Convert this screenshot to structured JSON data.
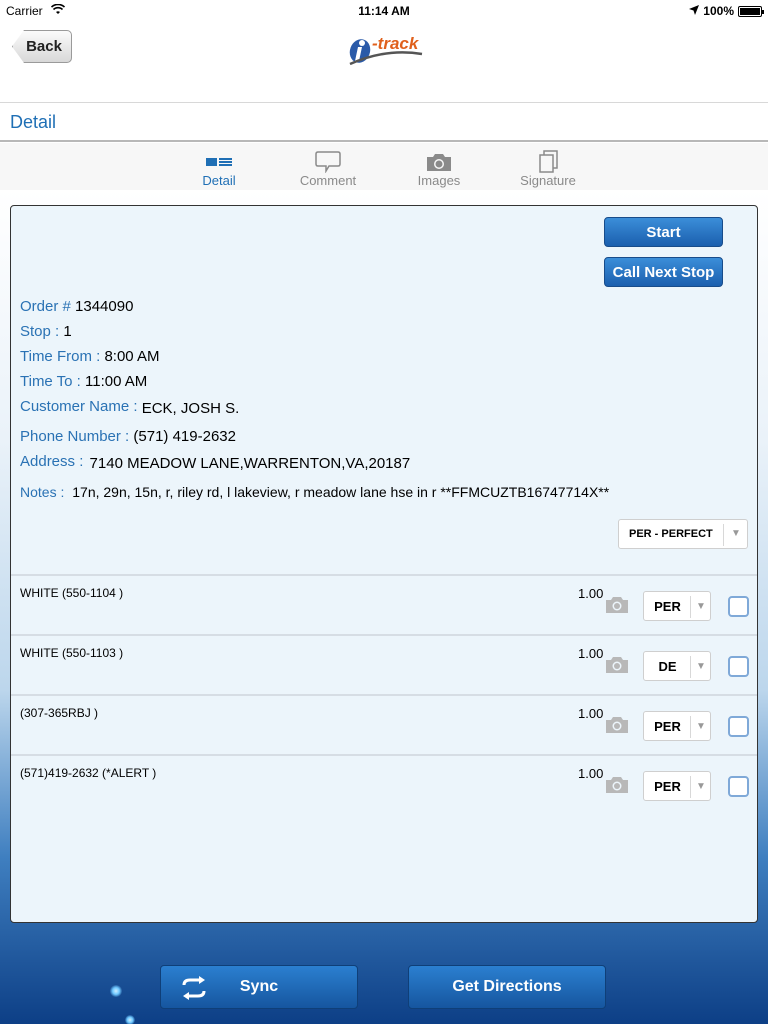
{
  "status_bar": {
    "carrier": "Carrier",
    "time": "11:14 AM",
    "battery": "100%"
  },
  "nav": {
    "back_label": "Back",
    "logo_text": "-track"
  },
  "page_title": "Detail",
  "tabs": [
    {
      "label": "Detail",
      "icon": "list-icon",
      "active": true
    },
    {
      "label": "Comment",
      "icon": "comment-bubble-icon",
      "active": false
    },
    {
      "label": "Images",
      "icon": "camera-icon",
      "active": false
    },
    {
      "label": "Signature",
      "icon": "document-stack-icon",
      "active": false
    }
  ],
  "actions": {
    "start_label": "Start",
    "call_next_label": "Call Next Stop"
  },
  "details": {
    "order": {
      "label": "Order #",
      "value": "1344090"
    },
    "stop": {
      "label": "Stop :",
      "value": "1"
    },
    "time_from": {
      "label": "Time From :",
      "value": "8:00 AM"
    },
    "time_to": {
      "label": "Time To :",
      "value": "11:00 AM"
    },
    "customer": {
      "label": "Customer Name :",
      "value": "ECK, JOSH S."
    },
    "phone": {
      "label": "Phone Number :",
      "value": "(571) 419-2632"
    },
    "address": {
      "label": "Address :",
      "value": "7140 MEADOW LANE,WARRENTON,VA,20187"
    },
    "notes": {
      "label": "Notes :",
      "value": "17n, 29n, 15n, r, riley rd, l lakeview, r meadow lane hse in r **FFMCUZTB16747714X**"
    }
  },
  "order_status": "PER - PERFECT",
  "items": [
    {
      "name": "WHITE (550-1104 )",
      "qty": "1.00",
      "status": "PER",
      "checked": false
    },
    {
      "name": "WHITE (550-1103 )",
      "qty": "1.00",
      "status": "DE",
      "checked": false
    },
    {
      "name": "(307-365RBJ )",
      "qty": "1.00",
      "status": "PER",
      "checked": false
    },
    {
      "name": "(571)419-2632 (*ALERT )",
      "qty": "1.00",
      "status": "PER",
      "checked": false
    }
  ],
  "bottom": {
    "sync_label": "Sync",
    "directions_label": "Get Directions"
  },
  "colors": {
    "accent": "#1f6fb5",
    "button": "#1b5fae",
    "card_bg": "#ecf5fb",
    "logo_orange": "#e0601c"
  }
}
